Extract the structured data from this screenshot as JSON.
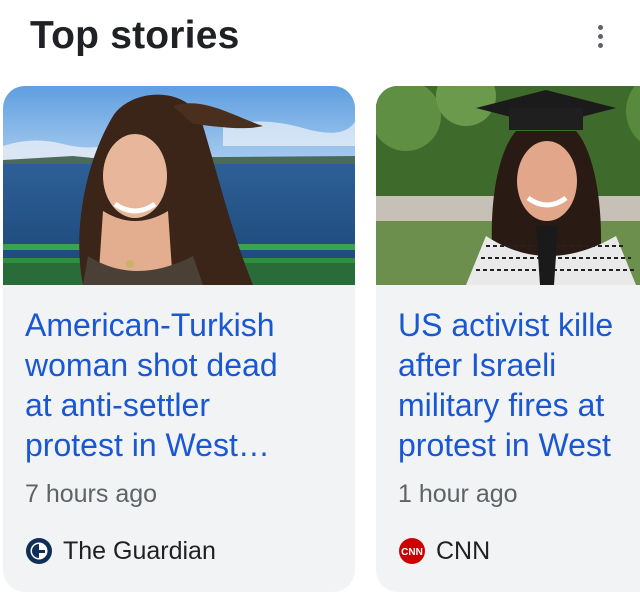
{
  "header": {
    "title": "Top stories",
    "more_icon": "more-vert-icon"
  },
  "cards": [
    {
      "headline": "American-Turkish\nwoman shot dead\nat anti-settler\nprotest in West…",
      "time": "7 hours ago",
      "source": "The Guardian",
      "source_logo": "guardian-logo"
    },
    {
      "headline": "US activist kille\nafter Israeli\nmilitary fires at\nprotest in West",
      "time": "1 hour ago",
      "source": "CNN",
      "source_logo": "cnn-logo"
    }
  ],
  "colors": {
    "headline": "#1a57d2",
    "card_bg": "#f1f3f4",
    "meta_text": "#5f6368",
    "title_text": "#202124"
  }
}
